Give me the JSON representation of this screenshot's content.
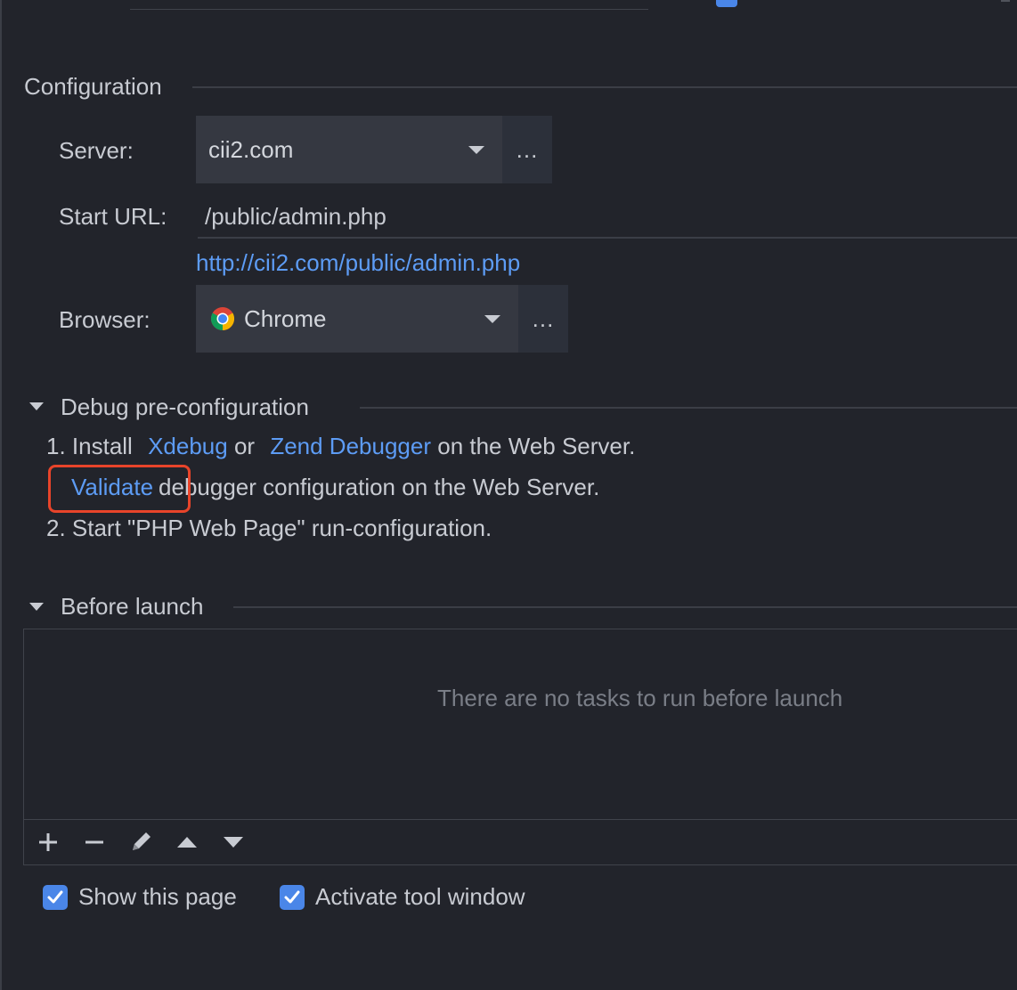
{
  "configuration": {
    "title": "Configuration",
    "server_label": "Server:",
    "server_value": "cii2.com",
    "server_more": "...",
    "start_url_label": "Start URL:",
    "start_url_value": "/public/admin.php",
    "resolved_url": "http://cii2.com/public/admin.php",
    "browser_label": "Browser:",
    "browser_value": "Chrome",
    "browser_icon": "chrome-icon",
    "browser_more": "..."
  },
  "debug": {
    "title": "Debug pre-configuration",
    "step1_prefix": "1. Install",
    "xdebug_link": "Xdebug",
    "or_text": "or",
    "zend_link": "Zend Debugger",
    "step1_suffix": "on the Web Server.",
    "validate_link": "Validate",
    "validate_suffix": "debugger configuration on the Web Server.",
    "step2": "2. Start \"PHP Web Page\" run-configuration."
  },
  "before_launch": {
    "title": "Before launch",
    "empty_message": "There are no tasks to run before launch",
    "toolbar": [
      "add-icon",
      "remove-icon",
      "edit-icon",
      "move-up-icon",
      "move-down-icon"
    ]
  },
  "options": {
    "show_page_label": "Show this page",
    "show_page_checked": true,
    "activate_tool_label": "Activate tool window",
    "activate_tool_checked": true
  },
  "colors": {
    "background": "#22242b",
    "link": "#5d9cf5",
    "checkbox": "#4a86e8",
    "highlight": "#e8442a"
  }
}
